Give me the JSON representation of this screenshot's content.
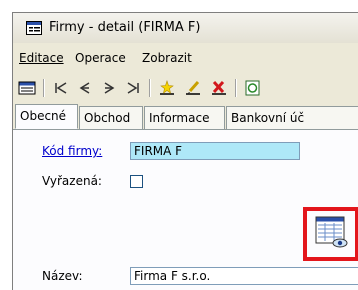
{
  "window": {
    "title": "Firmy - detail (FIRMA F)"
  },
  "menubar": {
    "items": [
      "Editace",
      "Operace",
      "Zobrazit"
    ]
  },
  "toolbar": {
    "buttons": [
      "record-icon",
      "first-record-icon",
      "previous-record-icon",
      "next-record-icon",
      "last-record-icon",
      "new-record-icon",
      "edit-record-icon",
      "delete-record-icon",
      "refresh-icon"
    ]
  },
  "tabs": [
    "Obecné",
    "Obchod",
    "Informace",
    "Bankovní úč"
  ],
  "form": {
    "kod_label": "Kód firmy:",
    "kod_value": "FIRMA F",
    "vyrazena_label": "Vyřazená:",
    "nazev_label": "Název:",
    "nazev_value": "Firma F s.r.o."
  },
  "colors": {
    "highlight": "#e3161c",
    "selected_field": "#aee8f8",
    "link": "#0000cc"
  }
}
